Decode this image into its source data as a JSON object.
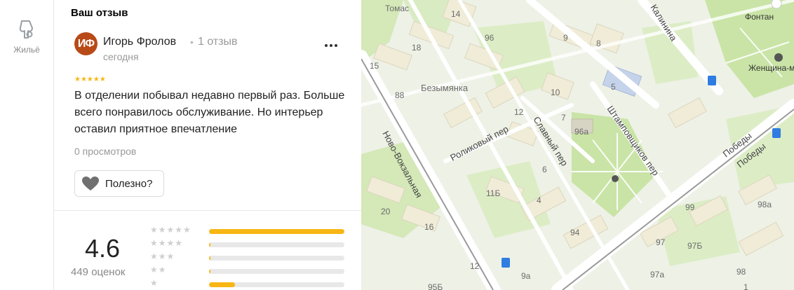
{
  "rail": {
    "housing_label": "Жильё",
    "housing_icon": "housing-icon"
  },
  "review": {
    "section_title": "Ваш отзыв",
    "avatar_initials": "ИФ",
    "author": "Игорь Фролов",
    "separator": "•",
    "author_review_count": "1 отзыв",
    "date": "сегодня",
    "rating_stars": "★★★★★",
    "text": "В отделении побывал недавно первый раз. Больше всего понравилось обслуживание. Но интерьер оставил приятное впечатление",
    "views": "0 просмотров",
    "useful_label": "Полезно?"
  },
  "rating_summary": {
    "average": "4.6",
    "count_label": "449 оценок",
    "rows": [
      {
        "stars": "★★★★★",
        "fraction": 1.0
      },
      {
        "stars": "★★★★",
        "fraction": 0.01
      },
      {
        "stars": "★★★",
        "fraction": 0.01
      },
      {
        "stars": "★★",
        "fraction": 0.01
      },
      {
        "stars": "★",
        "fraction": 0.19
      }
    ]
  },
  "colors": {
    "accent": "#f7b614",
    "avatar": "#b84a18",
    "park": "#c9e4a6",
    "road": "#ffffff",
    "street_fill": "#f5efb8",
    "railway": "#9a9a9a"
  },
  "map": {
    "streets": [
      "Томас",
      "Безымянка",
      "Роликовый пер",
      "Славный пер",
      "Штамповщиков пер",
      "Ново-Вокзальная",
      "Калинина",
      "Победы",
      "Победы"
    ],
    "pois": [
      "Фонтан",
      "Женщина-м"
    ],
    "house_numbers": [
      "14",
      "96",
      "18",
      "9",
      "8",
      "15",
      "88",
      "5",
      "10",
      "96а",
      "12",
      "7",
      "6",
      "11Б",
      "4",
      "20",
      "16",
      "94",
      "99",
      "98а",
      "97",
      "97Б",
      "97а",
      "98",
      "12",
      "9а",
      "95Б",
      "1"
    ]
  }
}
